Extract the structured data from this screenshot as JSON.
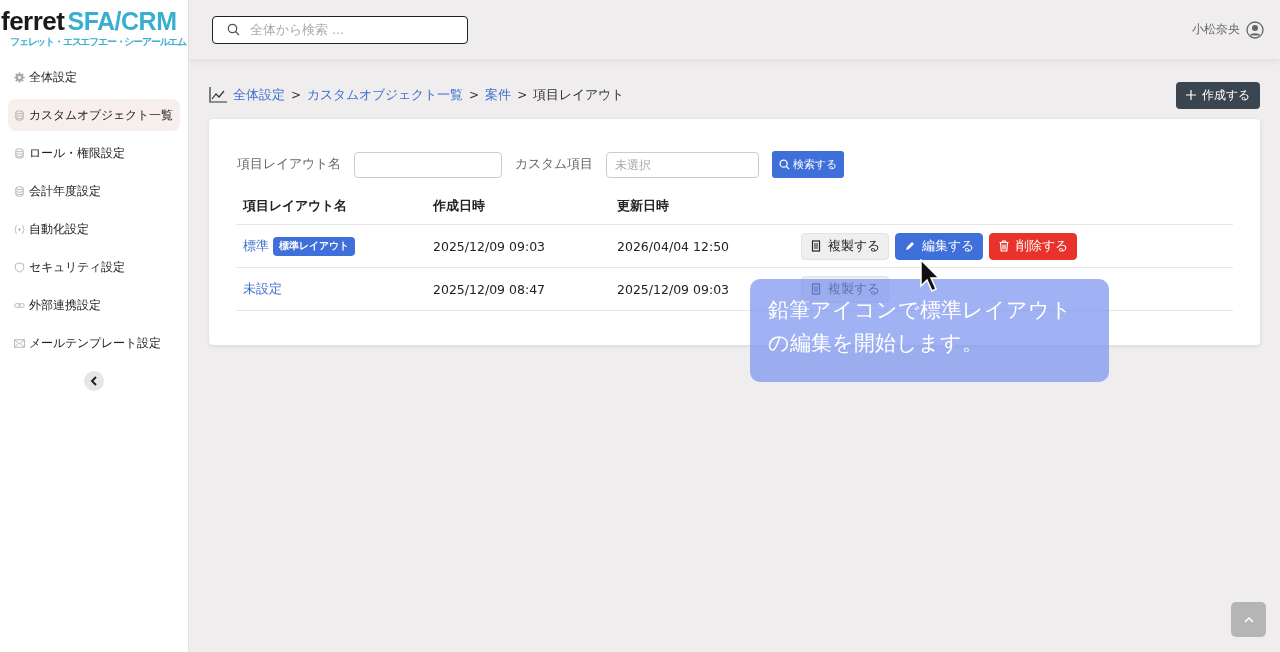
{
  "logo": {
    "brand": "ferret",
    "product": "SFA/CRM",
    "reading": "フェレット・エスエフエー・シーアールエム"
  },
  "sidebar": {
    "items": [
      {
        "label": "全体設定",
        "kind": "gear",
        "selected": false
      },
      {
        "label": "カスタムオブジェクト一覧",
        "kind": "database",
        "selected": true
      },
      {
        "label": "ロール・権限設定",
        "kind": "database",
        "selected": false
      },
      {
        "label": "会計年度設定",
        "kind": "database",
        "selected": false
      },
      {
        "label": "自動化設定",
        "kind": "braces",
        "selected": false
      },
      {
        "label": "セキュリティ設定",
        "kind": "shield",
        "selected": false
      },
      {
        "label": "外部連携設定",
        "kind": "link",
        "selected": false
      },
      {
        "label": "メールテンプレート設定",
        "kind": "mail",
        "selected": false
      }
    ]
  },
  "header": {
    "search_placeholder": "全体から検索 ...",
    "user": "小松奈央"
  },
  "breadcrumb": [
    {
      "label": "全体設定",
      "link": true
    },
    {
      "separator": ">",
      "label": "カスタムオブジェクト一覧",
      "link": true
    },
    {
      "separator": ">",
      "label": "案件",
      "link": true
    },
    {
      "separator": ">",
      "label": "項目レイアウト",
      "link": false
    }
  ],
  "create_button": "作成する",
  "filters": {
    "name_label": "項目レイアウト名",
    "custom_label": "カスタム項目",
    "custom_placeholder": "未選択",
    "search_button": "検索する"
  },
  "table": {
    "columns": [
      "項目レイアウト名",
      "作成日時",
      "更新日時"
    ],
    "rows": [
      {
        "name": "標準",
        "badge": "標準レイアウト",
        "created": "2025/12/09 09:03",
        "updated": "2026/04/04 12:50",
        "actions": [
          {
            "kind": "copy",
            "label": "複製する"
          },
          {
            "kind": "edit",
            "label": "編集する"
          },
          {
            "kind": "delete",
            "label": "削除する"
          }
        ]
      },
      {
        "name": "未設定",
        "created": "2025/12/09 08:47",
        "updated": "2025/12/09 09:03",
        "actions": [
          {
            "kind": "copy",
            "label": "複製する"
          }
        ]
      }
    ]
  },
  "tutorial_tip": "鉛筆アイコンで標準レイアウトの編集を開始します。"
}
